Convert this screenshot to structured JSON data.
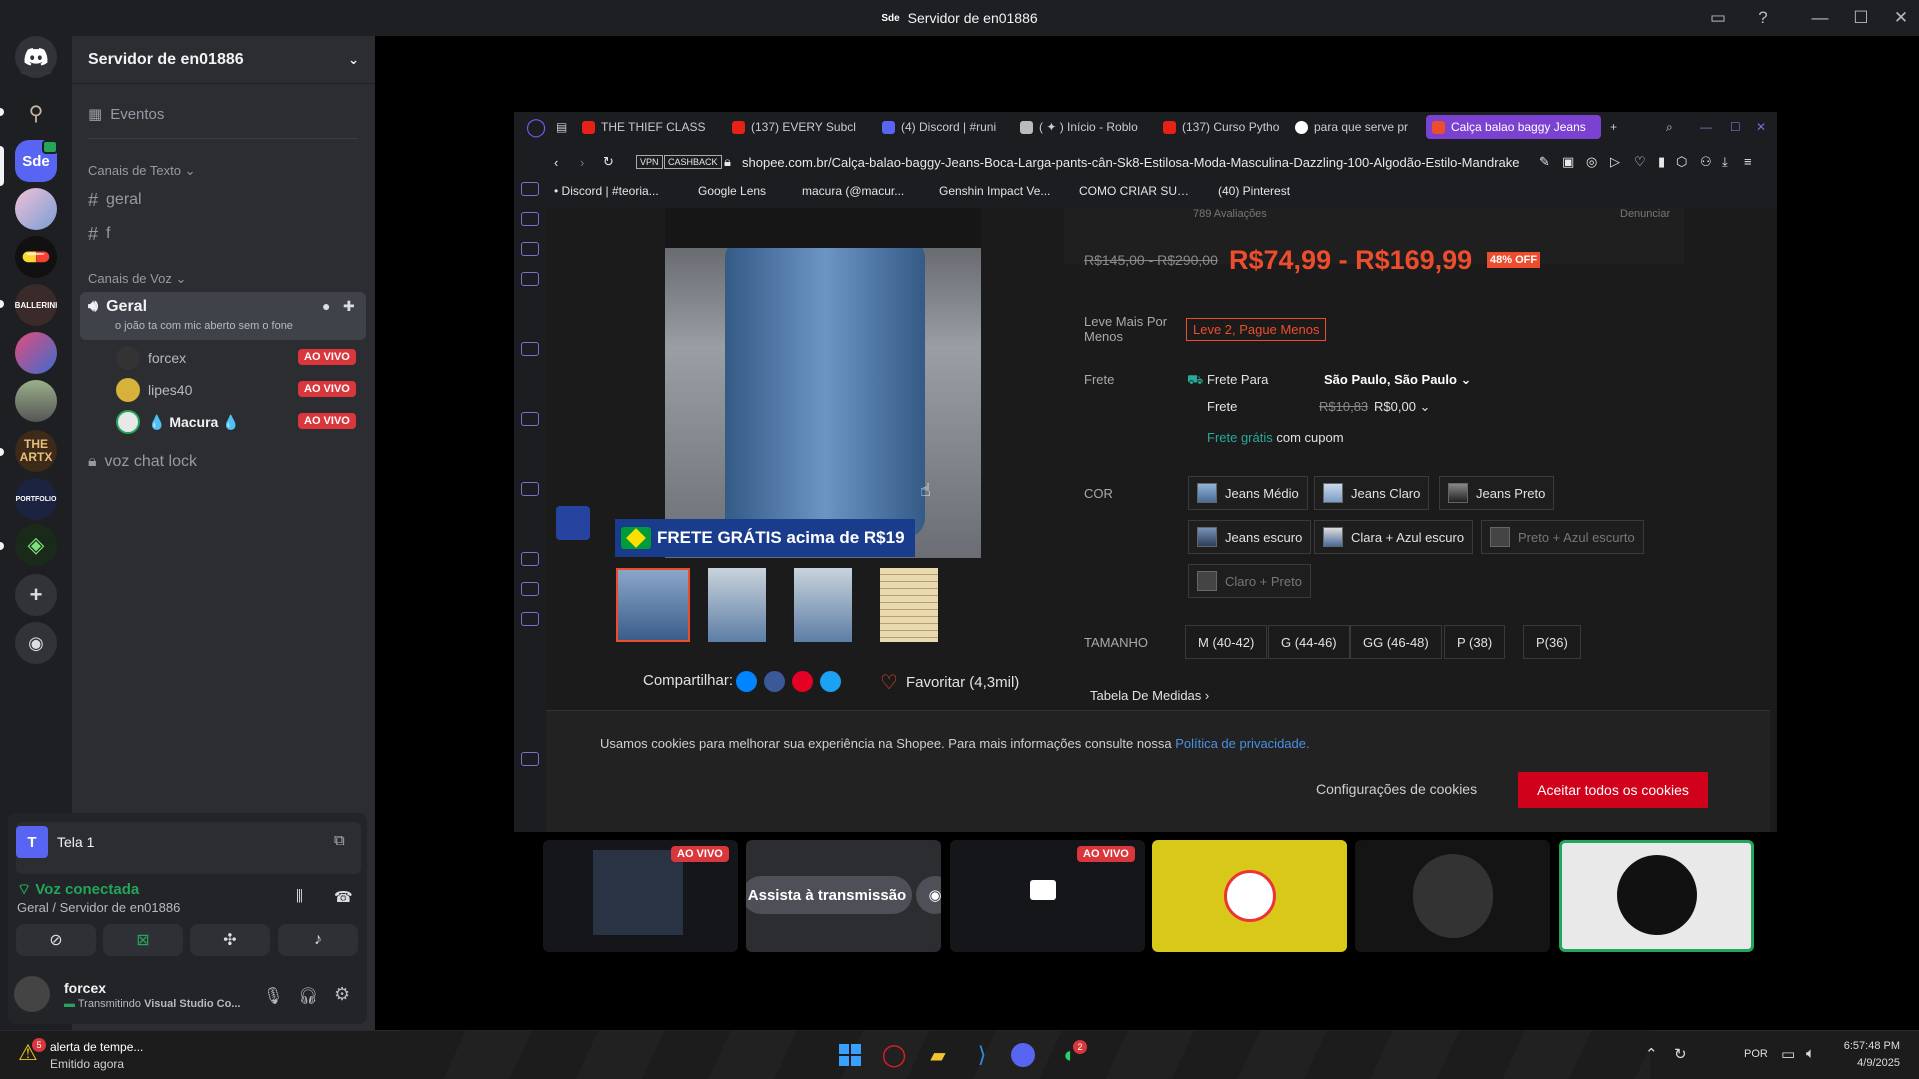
{
  "window": {
    "server_tag": "Sde",
    "title": "Servidor de en01886"
  },
  "server_rail": [
    {
      "label": "",
      "icon": "discord-logo"
    },
    {
      "label": "",
      "icon": "figure-art"
    },
    {
      "label": "Sde",
      "icon": "text"
    },
    {
      "label": "",
      "icon": "anime-art"
    },
    {
      "label": "",
      "icon": "pill-icon"
    },
    {
      "label": "BALLERINI",
      "icon": "text"
    },
    {
      "label": "",
      "icon": "game-art"
    },
    {
      "label": "",
      "icon": "landscape-art"
    },
    {
      "label": "THE ARTX",
      "icon": "text"
    },
    {
      "label": "PORTFOLIO",
      "icon": "text"
    },
    {
      "label": "",
      "icon": "alien-art"
    },
    {
      "label": "",
      "icon": "add-server-icon"
    },
    {
      "label": "",
      "icon": "explore-icon"
    }
  ],
  "server": {
    "name": "Servidor de en01886",
    "events": "Eventos"
  },
  "text_category": "Canais de Texto",
  "text_channels": [
    "geral",
    "f"
  ],
  "voice_category": "Canais de Voz",
  "voice_channel": {
    "name": "Geral",
    "status": "o joão ta com mic aberto sem o fone"
  },
  "voice_members": [
    {
      "name": "forcex",
      "badge": "AO VIVO"
    },
    {
      "name": "lipes40",
      "badge": "AO VIVO"
    },
    {
      "name": "💧 Macura 💧",
      "badge": "AO VIVO"
    }
  ],
  "locked_channel": "voz chat lock",
  "stream_card": {
    "title": "Tela 1",
    "avatar_letter": "T"
  },
  "voice_status": {
    "label": "Voz conectada",
    "location": "Geral / Servidor de en01886"
  },
  "user": {
    "name": "forcex",
    "activity_prefix": "Transmitindo ",
    "activity_app": "Visual Studio Co..."
  },
  "browser": {
    "tabs": [
      {
        "label": "THE THIEF CLASS",
        "color": "#e62117"
      },
      {
        "label": "(137) EVERY Subcl",
        "color": "#e62117"
      },
      {
        "label": "(4) Discord | #runi",
        "color": "#5865f2"
      },
      {
        "label": "( ✦ ) Início - Roblo",
        "color": "#bbbbbb"
      },
      {
        "label": "(137) Curso Pytho",
        "color": "#e62117"
      },
      {
        "label": "para que serve pr",
        "color": "#4285f4"
      },
      {
        "label": "Calça balao baggy Jeans",
        "color": "#ee4d2d"
      }
    ],
    "vpn": "VPN",
    "cashback": "CASHBACK",
    "url": "shopee.com.br/Calça-balao-baggy-Jeans-Boca-Larga-pants-cân-Sk8-Estilosa-Moda-Masculina-Dazzling-100-Algodão-Estilo-Mandrake",
    "bookmarks": [
      "• Discord | #teoria...",
      "Google Lens",
      "macura (@macur...",
      "Genshin Impact Ve...",
      "COMO CRIAR SUA...",
      "(40) Pinterest"
    ]
  },
  "product": {
    "rating_text": "789 Avaliações",
    "report": "Denunciar",
    "old_price": "R$145,00 - R$290,00",
    "price": "R$74,99 - R$169,99",
    "discount": "48% OFF",
    "promo_label": "Leve Mais Por Menos",
    "promo": "Leve 2, Pague Menos",
    "shipping_label": "Frete",
    "shipping_to_label": "Frete Para",
    "shipping_to": "São Paulo, São Paulo",
    "freight_label": "Frete",
    "freight_old": "R$10,83",
    "freight_new": "R$0,00",
    "free_ship": "Frete grátis",
    "free_ship_suffix": " com cupom",
    "color_label": "COR",
    "colors": [
      "Jeans Médio",
      "Jeans Claro",
      "Jeans Preto",
      "Jeans escuro",
      "Clara + Azul escuro",
      "Preto + Azul escurto",
      "Claro + Preto"
    ],
    "size_label": "TAMANHO",
    "sizes": [
      "M (40-42)",
      "G (44-46)",
      "GG (46-48)",
      "P (38)",
      "P(36)"
    ],
    "size_table": "Tabela De Medidas",
    "banner": "FRETE GRÁTIS acima de R$19",
    "share": "Compartilhar:",
    "favorite": "Favoritar (4,3mil)",
    "cookie_text": "Usamos cookies para melhorar sua experiência na Shopee. Para mais informações consulte nossa ",
    "cookie_link": "Política de privacidade.",
    "cookie_settings": "Configurações de cookies",
    "cookie_accept": "Aceitar todos os cookies"
  },
  "stream_tiles": [
    {
      "badge": "AO VIVO"
    },
    {
      "label": "Assista à transmissão"
    },
    {
      "badge": "AO VIVO"
    }
  ],
  "taskbar": {
    "notification_title": "alerta de tempe...",
    "notification_sub": "Emitido agora",
    "notification_count": "5",
    "discord_badge": "2",
    "lang": "POR",
    "time": "6:57:48 PM",
    "date": "4/9/2025"
  },
  "colors": {
    "accent": "#5865f2",
    "live": "#da373c",
    "shopee": "#ee4d2d",
    "voice_green": "#23a55a"
  }
}
